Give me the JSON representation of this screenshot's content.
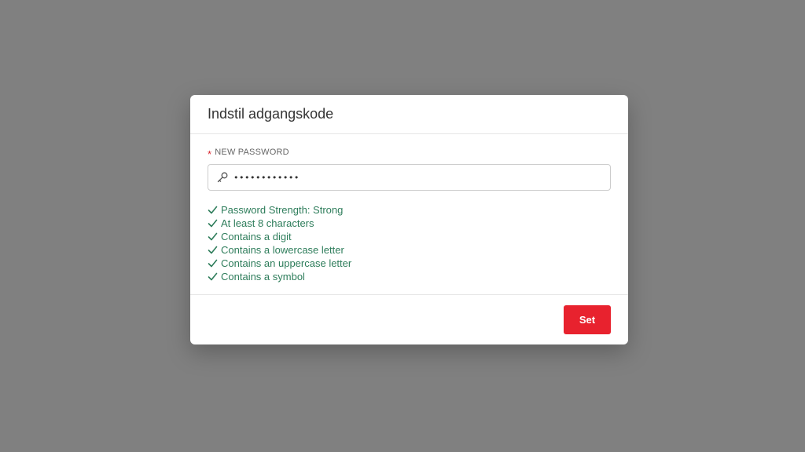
{
  "dialog": {
    "title": "Indstil adgangskode",
    "field_label": "NEW PASSWORD",
    "required_mark": "*",
    "password_value": "••••••••••••",
    "rules": [
      "Password Strength: Strong",
      "At least 8 characters",
      "Contains a digit",
      "Contains a lowercase letter",
      "Contains an uppercase letter",
      "Contains a symbol"
    ],
    "set_label": "Set"
  },
  "icons": {
    "field": "key-icon",
    "rule": "check-icon"
  },
  "colors": {
    "overlay": "#808080",
    "accent": "#e8222e",
    "success": "#2e7d5b",
    "required": "#d9262e"
  }
}
